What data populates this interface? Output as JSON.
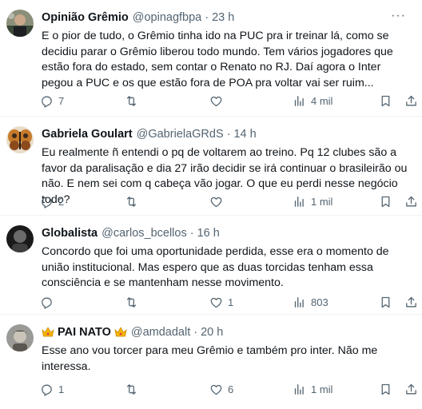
{
  "tweets": [
    {
      "name": "Opinião Grêmio",
      "handle": "@opinagfbpa",
      "dot": "·",
      "time": "23 h",
      "text": "E o pior de tudo, o Grêmio tinha ido na PUC pra ir treinar lá, como se decidiu parar o Grêmio liberou todo mundo. Tem vários jogadores que estão fora do estado, sem contar o Renato no RJ. Daí agora o Inter pegou a PUC e os que estão fora de POA pra voltar vai ser ruim...",
      "replies": "7",
      "retweets": "",
      "likes": "",
      "views": "4 mil"
    },
    {
      "name": "Gabriela Goulart",
      "handle": "@GabrielaGRdS",
      "dot": "·",
      "time": "14 h",
      "text": "Eu realmente ñ entendi o pq de voltarem ao treino. Pq 12 clubes são a favor da paralisação e dia 27 irão decidir se irá continuar o brasileirão ou não. E nem sei com q cabeça vão jogar. O que eu perdi nesse negócio todo?",
      "replies": "2",
      "retweets": "",
      "likes": "",
      "views": "1 mil"
    },
    {
      "name": "Globalista",
      "handle": "@carlos_bcellos",
      "dot": "·",
      "time": "16 h",
      "text": "Concordo que foi uma oportunidade perdida, esse era o momento de união institucional. Mas espero que as duas torcidas tenham essa consciência e se mantenham nesse movimento.",
      "replies": "",
      "retweets": "",
      "likes": "1",
      "views": "803"
    },
    {
      "name": "PAI NATO",
      "handle": "@amdadalt",
      "dot": "·",
      "time": "20 h",
      "text": "Esse ano vou torcer para meu Grêmio e também pro inter. Não me interessa.",
      "replies": "1",
      "retweets": "",
      "likes": "6",
      "views": "1 mil"
    }
  ],
  "more_glyph": "···",
  "icons": {
    "reply": "reply-icon",
    "retweet": "retweet-icon",
    "like": "heart-icon",
    "views": "views-icon",
    "bookmark": "bookmark-icon",
    "share": "share-icon",
    "crown": "crown-emoji-icon"
  },
  "colors": {
    "text": "#0f1419",
    "secondary": "#536471",
    "divider": "#eff3f4"
  }
}
